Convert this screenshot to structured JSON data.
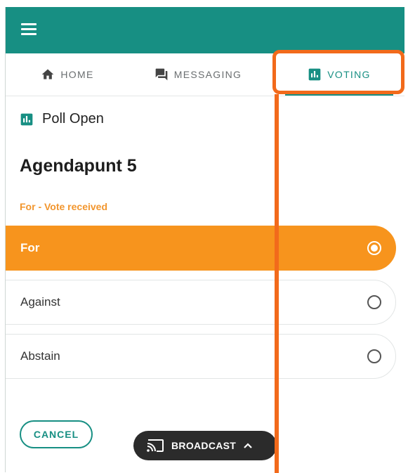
{
  "tabs": [
    {
      "label": "HOME",
      "icon": "home-icon"
    },
    {
      "label": "MESSAGING",
      "icon": "chat-icon"
    },
    {
      "label": "VOTING",
      "icon": "poll-icon"
    }
  ],
  "poll": {
    "status": "Poll Open",
    "title": "Agendapunt 5",
    "vote_status": "For - Vote received",
    "options": [
      {
        "label": "For",
        "selected": true
      },
      {
        "label": "Against",
        "selected": false
      },
      {
        "label": "Abstain",
        "selected": false
      }
    ]
  },
  "actions": {
    "cancel_label": "CANCEL",
    "broadcast_label": "BROADCAST"
  },
  "colors": {
    "brand": "#178f83",
    "accent": "#f7941d",
    "highlight": "#f26a1b"
  }
}
